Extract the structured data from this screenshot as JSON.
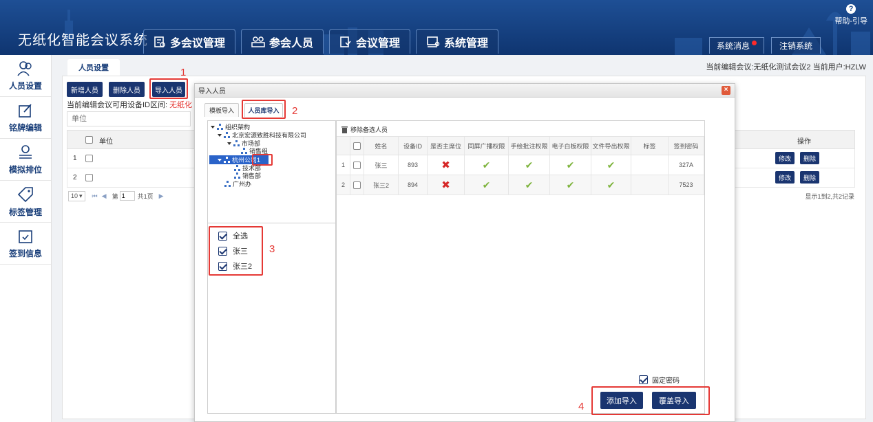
{
  "app": {
    "title": "无纸化智能会议系统"
  },
  "nav": [
    {
      "label": "多会议管理",
      "icon": "meeting-list-icon"
    },
    {
      "label": "参会人员",
      "icon": "people-icon"
    },
    {
      "label": "会议管理",
      "icon": "meeting-manage-icon"
    },
    {
      "label": "系统管理",
      "icon": "system-icon"
    }
  ],
  "header": {
    "help_label": "帮助-引导",
    "system_message": "系统消息",
    "logout": "注销系统"
  },
  "sidebar": {
    "items": [
      {
        "label": "人员设置",
        "icon": "people-icon"
      },
      {
        "label": "铭牌编辑",
        "icon": "edit-icon"
      },
      {
        "label": "模拟排位",
        "icon": "seat-icon"
      },
      {
        "label": "标签管理",
        "icon": "tag-icon"
      },
      {
        "label": "签到信息",
        "icon": "calendar-check-icon"
      }
    ]
  },
  "main": {
    "tab": "人员设置",
    "meeting_info": "当前编辑会议:无纸化测试会议2    当前用户:HZLW",
    "toolbar": {
      "add": "新增人员",
      "delete": "删除人员",
      "import": "导入人员"
    },
    "device_range_label": "当前编辑会议可用设备ID区间:",
    "device_range_value": "无纸化",
    "filter_placeholder": "单位",
    "grid": {
      "col_unit": "单位",
      "col_action": "操作",
      "rows": [
        {
          "num": "1"
        },
        {
          "num": "2"
        }
      ],
      "edit_label": "修改",
      "delete_label": "删除"
    },
    "pager": {
      "page_size": "10",
      "page_prefix": "第",
      "page_value": "1",
      "page_total": "共1页",
      "summary": "显示1到2,共2记录"
    }
  },
  "dialog": {
    "title": "导入人员",
    "tab_template": "模板导入",
    "tab_library": "人员库导入",
    "tree": [
      {
        "label": "组织架构"
      },
      {
        "label": "北京宏源致胜科技有限公司"
      },
      {
        "label": "市场部"
      },
      {
        "label": "销售组"
      },
      {
        "label": "杭州公司1"
      },
      {
        "label": "技术部"
      },
      {
        "label": "销售部"
      },
      {
        "label": "广州办"
      }
    ],
    "checklist": [
      {
        "label": "全选"
      },
      {
        "label": "张三"
      },
      {
        "label": "张三2"
      }
    ],
    "remove_selected": "移除备选人员",
    "columns": [
      "姓名",
      "设备ID",
      "是否主席位",
      "同屏广播权限",
      "手绘批注权限",
      "电子白板权限",
      "文件导出权限",
      "标签",
      "签到密码"
    ],
    "rows": [
      {
        "num": "1",
        "name": "张三",
        "device": "893",
        "password": "327A"
      },
      {
        "num": "2",
        "name": "张三2",
        "device": "894",
        "password": "7523"
      }
    ],
    "fixed_password": "固定密码",
    "add_import": "添加导入",
    "overwrite_import": "覆盖导入"
  },
  "annotations": [
    "1",
    "2",
    "3",
    "4"
  ],
  "colors": {
    "header": "#1e4f95",
    "accent": "#1a3570",
    "highlight": "#e53935",
    "check_ok": "#7db33c",
    "check_no": "#d62828"
  }
}
